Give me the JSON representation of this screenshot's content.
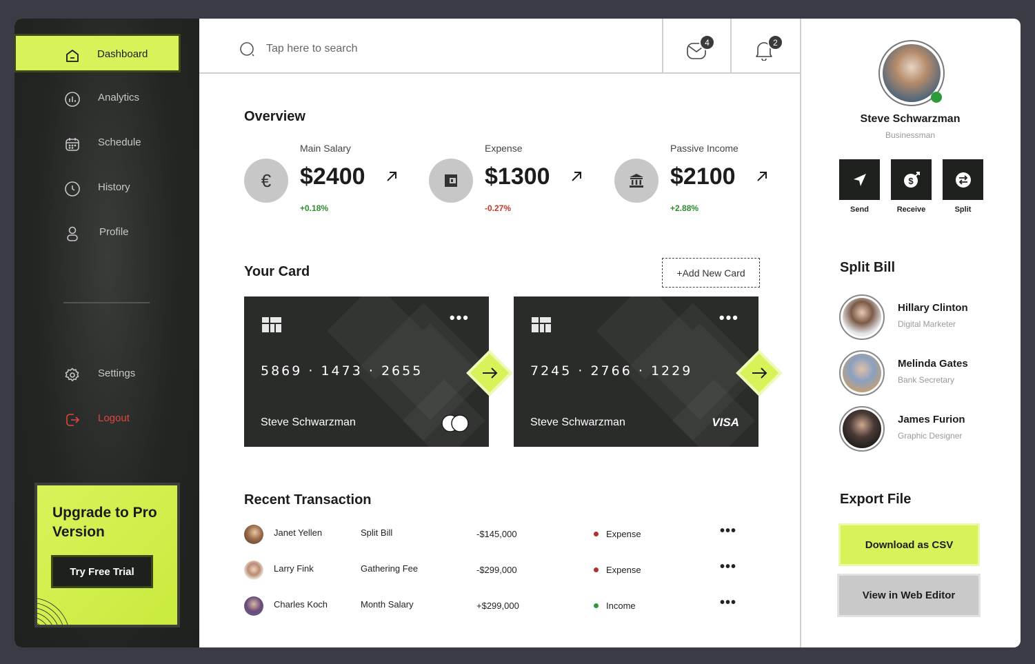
{
  "sidebar": {
    "items": [
      {
        "label": "Dashboard",
        "icon": "home-icon"
      },
      {
        "label": "Analytics",
        "icon": "analytics-icon"
      },
      {
        "label": "Schedule",
        "icon": "calendar-icon"
      },
      {
        "label": "History",
        "icon": "clock-icon"
      },
      {
        "label": "Profile",
        "icon": "user-icon"
      }
    ],
    "settings_label": "Settings",
    "logout_label": "Logout",
    "upgrade": {
      "title": "Upgrade to Pro Version",
      "button": "Try Free Trial"
    }
  },
  "topbar": {
    "search_placeholder": "Tap here to search",
    "messages_count": "4",
    "notifications_count": "2"
  },
  "overview": {
    "title": "Overview",
    "items": [
      {
        "label": "Main Salary",
        "value": "$2400",
        "change": "+0.18%",
        "icon": "euro-icon"
      },
      {
        "label": "Expense",
        "value": "$1300",
        "change": "-0.27%",
        "icon": "wallet-icon"
      },
      {
        "label": "Passive Income",
        "value": "$2100",
        "change": "+2.88%",
        "icon": "bank-icon"
      }
    ]
  },
  "cards": {
    "title": "Your Card",
    "add_label": "+Add New Card",
    "items": [
      {
        "number": "5869 · 1473 · 2655",
        "holder": "Steve Schwarzman",
        "brand": "mastercard"
      },
      {
        "number": "7245 · 2766 · 1229",
        "holder": "Steve Schwarzman",
        "brand": "VISA"
      }
    ]
  },
  "transactions": {
    "title": "Recent Transaction",
    "rows": [
      {
        "name": "Janet Yellen",
        "type": "Split Bill",
        "amount": "-$145,000",
        "status": "Expense"
      },
      {
        "name": "Larry Fink",
        "type": "Gathering Fee",
        "amount": "-$299,000",
        "status": "Expense"
      },
      {
        "name": "Charles Koch",
        "type": "Month Salary",
        "amount": "+$299,000",
        "status": "Income"
      }
    ]
  },
  "profile": {
    "name": "Steve Schwarzman",
    "role": "Businessman",
    "actions": [
      {
        "label": "Send",
        "icon": "send-icon"
      },
      {
        "label": "Receive",
        "icon": "receive-icon"
      },
      {
        "label": "Split",
        "icon": "split-icon"
      }
    ]
  },
  "split_bill": {
    "title": "Split Bill",
    "people": [
      {
        "name": "Hillary Clinton",
        "role": "Digital Marketer"
      },
      {
        "name": "Melinda Gates",
        "role": "Bank Secretary"
      },
      {
        "name": "James Furion",
        "role": "Graphic Designer"
      }
    ]
  },
  "export": {
    "title": "Export File",
    "csv_label": "Download as CSV",
    "web_label": "View in Web Editor"
  },
  "colors": {
    "accent": "#d8f35a",
    "dark": "#1f211f",
    "positive": "#2e8b2e",
    "negative": "#c0392b"
  }
}
